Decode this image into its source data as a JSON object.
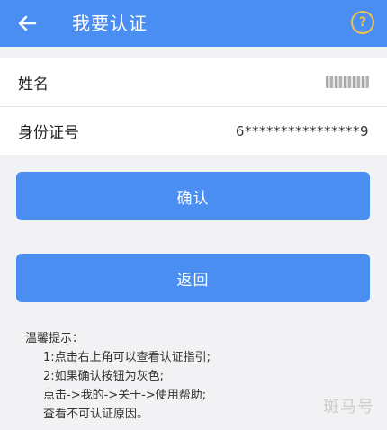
{
  "header": {
    "title": "我要认证",
    "help_icon_text": "?",
    "background_color": "#4a8ef2",
    "help_icon_color": "#f1c24f"
  },
  "form": {
    "name_label": "姓名",
    "name_value_redacted": true,
    "id_label": "身份证号",
    "id_value": "6****************9"
  },
  "buttons": {
    "confirm_label": "确认",
    "return_label": "返回"
  },
  "tips": {
    "title": "温馨提示：",
    "line1": "1:点击右上角可以查看认证指引;",
    "line2": "2:如果确认按钮为灰色;",
    "line3": "点击->我的->关于->使用帮助;",
    "line4": "查看不可认证原因。"
  },
  "watermark": "斑马号"
}
